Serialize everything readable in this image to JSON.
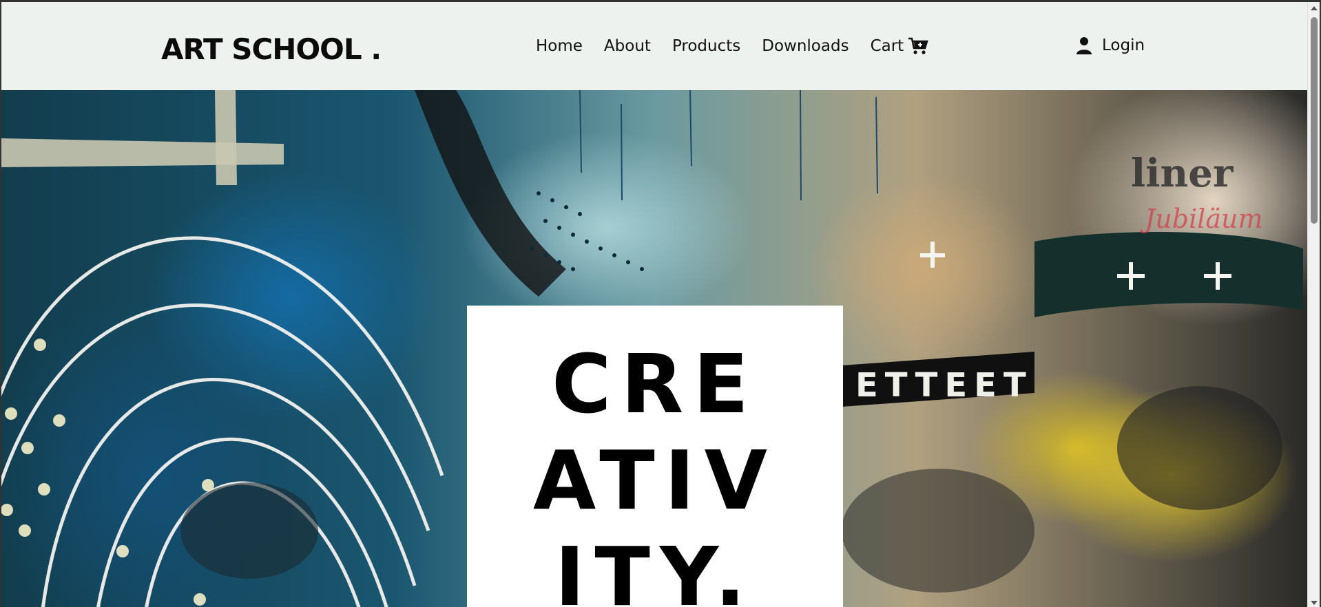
{
  "header": {
    "brand": "ART SCHOOL .",
    "nav": [
      {
        "label": "Home"
      },
      {
        "label": "About"
      },
      {
        "label": "Products"
      },
      {
        "label": "Downloads"
      },
      {
        "label": "Cart",
        "icon": "cart-plus-icon"
      }
    ],
    "login": {
      "label": "Login",
      "icon": "user-icon"
    }
  },
  "hero": {
    "background": "street-art collage image",
    "lines": [
      "CRE",
      "ATIV",
      "ITY."
    ]
  },
  "colors": {
    "header_bg": "#eef2ef",
    "text": "#111111",
    "hero_box": "#ffffff"
  }
}
